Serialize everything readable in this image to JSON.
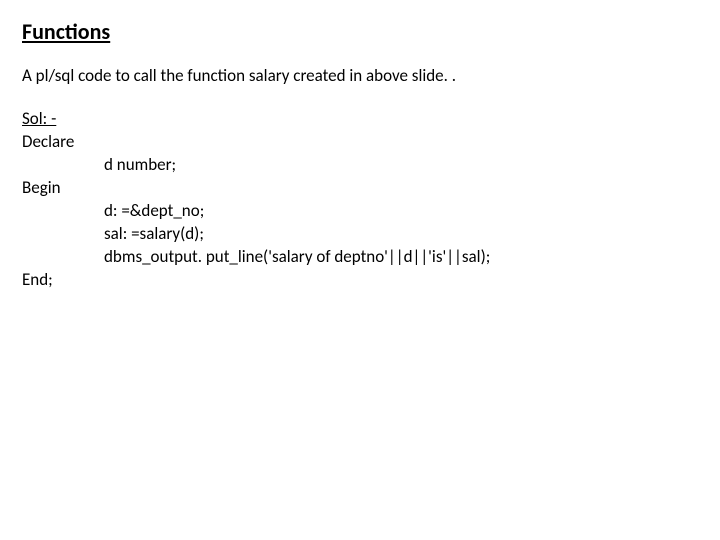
{
  "title": "Functions",
  "description": "A pl/sql code to call the function salary created in above slide. .",
  "solLabel": "Sol: -",
  "code": {
    "declare": "Declare",
    "varDecl": "d number;",
    "begin": "Begin",
    "line1": "d: =&dept_no;",
    "line2": "sal: =salary(d);",
    "line3": "dbms_output. put_line('salary of deptno'||d||'is'||sal);",
    "end": "End;"
  }
}
